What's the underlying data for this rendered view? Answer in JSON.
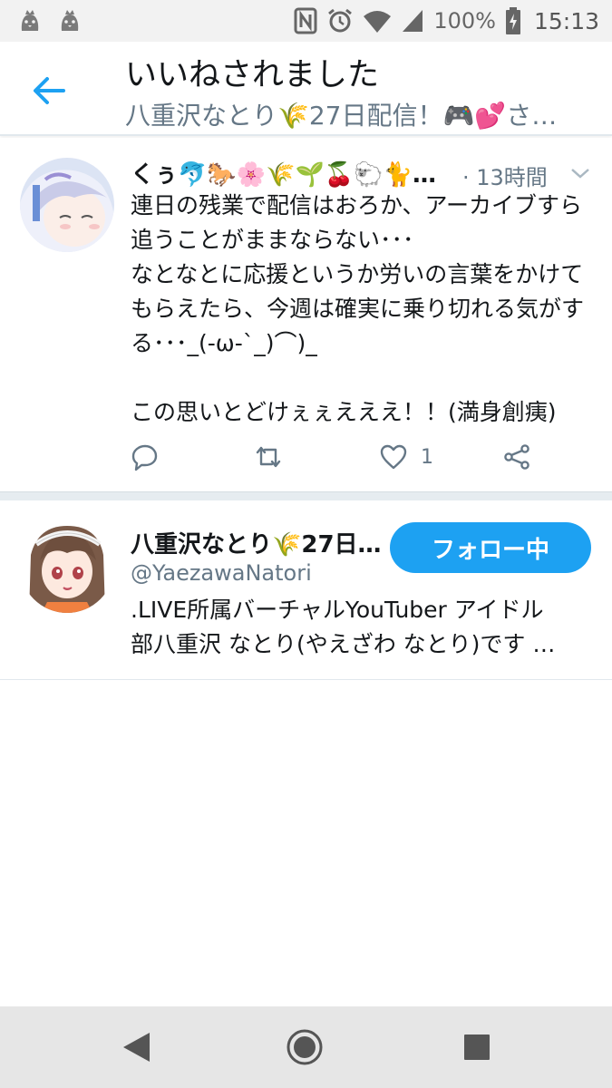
{
  "status_bar": {
    "left_icons": [
      "ghost-bird-icon",
      "ghost-bird-icon"
    ],
    "right_icons": [
      "nfc-icon",
      "alarm-icon",
      "wifi-icon",
      "signal-icon",
      "battery-charging-icon"
    ],
    "battery": "100%",
    "time": "15:13"
  },
  "header": {
    "title": "いいねされました",
    "subtitle": "八重沢なとり🌾27日配信！🎮💕さ…"
  },
  "tweet": {
    "author_name": "くぅ🐬🐎🌸🌾🌱🍒🐑🐈…",
    "time": "· 13時間",
    "body": "連日の残業で配信はおろか、アーカイブすら追うことがままならない･･･\nなとなとに応援というか労いの言葉をかけてもらえたら、今週は確実に乗り切れる気がする･･･_(-ω-`_)⌒)_\n\nこの思いとどけぇぇえええ！！(満身創痍)",
    "like_count": "1"
  },
  "user_card": {
    "name": "八重沢なとり🌾27日…",
    "handle": "@YaezawaNatori",
    "follow_label": "フォロー中",
    "bio_line1": ".LIVE所属バーチャルYouTuber アイドル",
    "bio_line2": "部八重沢 なとり(やえざわ なとり)です …"
  },
  "colors": {
    "accent": "#1da1f2",
    "text_primary": "#14171a",
    "text_secondary": "#657786"
  }
}
